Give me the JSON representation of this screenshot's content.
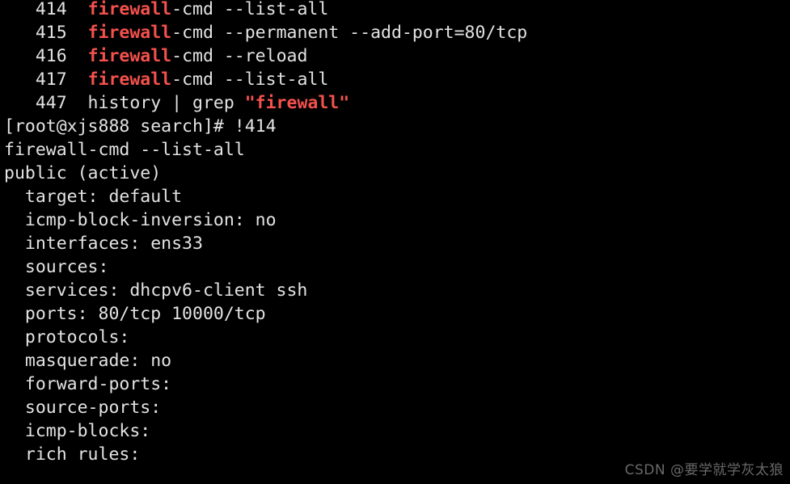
{
  "terminal": {
    "background_color": "#000000",
    "foreground_color": "#e3e3e3",
    "highlight_color": "#f4514d",
    "lines": [
      {
        "id": "history-414",
        "segments": [
          {
            "text": "   414  ",
            "highlight": false
          },
          {
            "text": "firewall",
            "highlight": true
          },
          {
            "text": "-cmd --list-all",
            "highlight": false
          }
        ]
      },
      {
        "id": "history-415",
        "segments": [
          {
            "text": "   415  ",
            "highlight": false
          },
          {
            "text": "firewall",
            "highlight": true
          },
          {
            "text": "-cmd --permanent --add-port=80/tcp",
            "highlight": false
          }
        ]
      },
      {
        "id": "history-416",
        "segments": [
          {
            "text": "   416  ",
            "highlight": false
          },
          {
            "text": "firewall",
            "highlight": true
          },
          {
            "text": "-cmd --reload",
            "highlight": false
          }
        ]
      },
      {
        "id": "history-417",
        "segments": [
          {
            "text": "   417  ",
            "highlight": false
          },
          {
            "text": "firewall",
            "highlight": true
          },
          {
            "text": "-cmd --list-all",
            "highlight": false
          }
        ]
      },
      {
        "id": "history-447",
        "segments": [
          {
            "text": "   447  history | grep ",
            "highlight": false
          },
          {
            "text": "\"",
            "highlight": true
          },
          {
            "text": "firewall",
            "highlight": true
          },
          {
            "text": "\"",
            "highlight": true
          }
        ]
      },
      {
        "id": "prompt-command",
        "segments": [
          {
            "text": "[root@xjs888 search]# !414",
            "highlight": false
          }
        ]
      },
      {
        "id": "echoed-command",
        "segments": [
          {
            "text": "firewall-cmd --list-all",
            "highlight": false
          }
        ]
      },
      {
        "id": "output-zone",
        "segments": [
          {
            "text": "public (active)",
            "highlight": false
          }
        ]
      },
      {
        "id": "output-target",
        "segments": [
          {
            "text": "  target: default",
            "highlight": false
          }
        ]
      },
      {
        "id": "output-icmp-block-inversion",
        "segments": [
          {
            "text": "  icmp-block-inversion: no",
            "highlight": false
          }
        ]
      },
      {
        "id": "output-interfaces",
        "segments": [
          {
            "text": "  interfaces: ens33",
            "highlight": false
          }
        ]
      },
      {
        "id": "output-sources",
        "segments": [
          {
            "text": "  sources: ",
            "highlight": false
          }
        ]
      },
      {
        "id": "output-services",
        "segments": [
          {
            "text": "  services: dhcpv6-client ssh",
            "highlight": false
          }
        ]
      },
      {
        "id": "output-ports",
        "segments": [
          {
            "text": "  ports: 80/tcp 10000/tcp",
            "highlight": false
          }
        ]
      },
      {
        "id": "output-protocols",
        "segments": [
          {
            "text": "  protocols: ",
            "highlight": false
          }
        ]
      },
      {
        "id": "output-masquerade",
        "segments": [
          {
            "text": "  masquerade: no",
            "highlight": false
          }
        ]
      },
      {
        "id": "output-forward-ports",
        "segments": [
          {
            "text": "  forward-ports: ",
            "highlight": false
          }
        ]
      },
      {
        "id": "output-source-ports",
        "segments": [
          {
            "text": "  source-ports: ",
            "highlight": false
          }
        ]
      },
      {
        "id": "output-icmp-blocks",
        "segments": [
          {
            "text": "  icmp-blocks: ",
            "highlight": false
          }
        ]
      },
      {
        "id": "output-rich-rules",
        "segments": [
          {
            "text": "  rich rules: ",
            "highlight": false
          }
        ]
      }
    ]
  },
  "watermark": {
    "text": "CSDN @要学就学灰太狼"
  }
}
